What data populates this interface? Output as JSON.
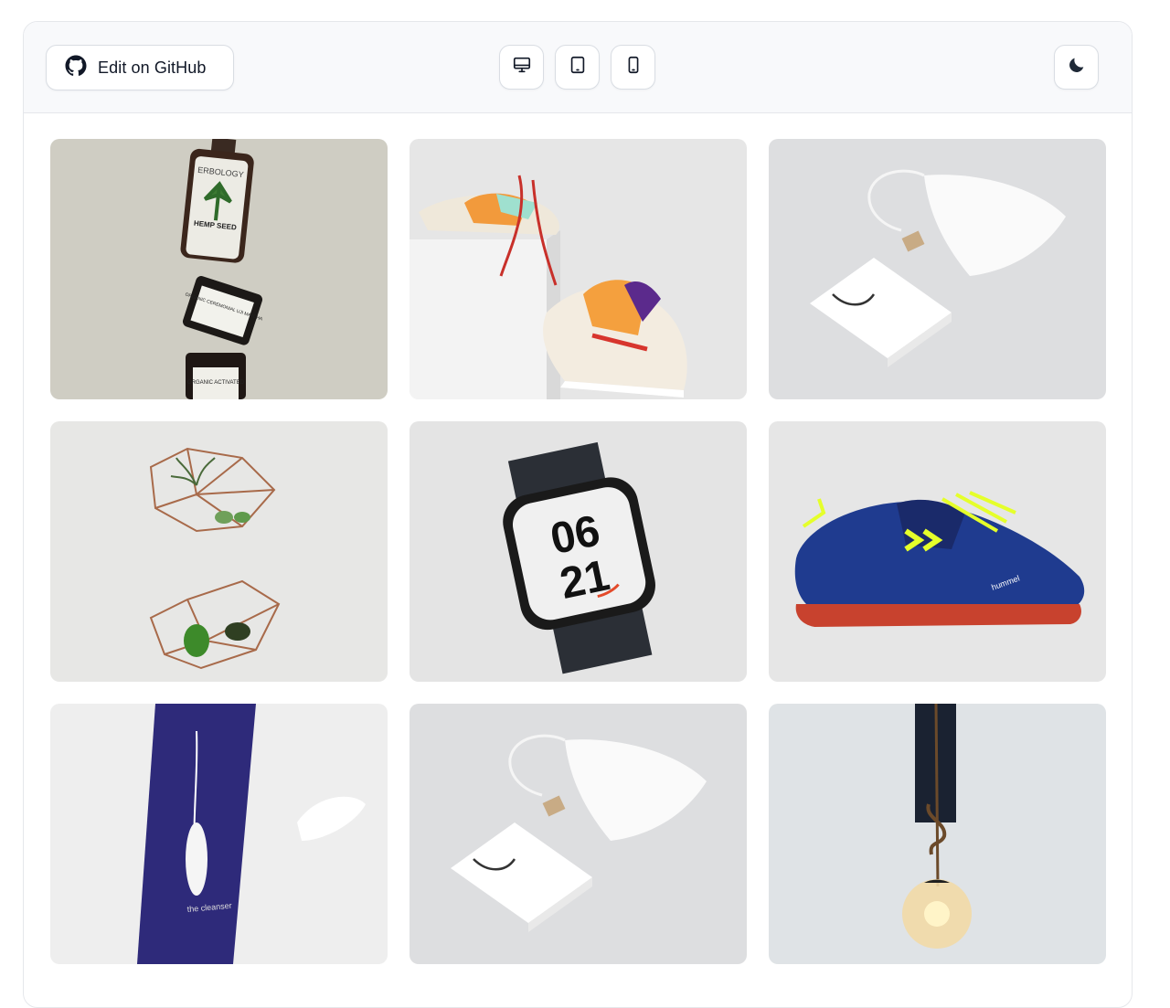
{
  "toolbar": {
    "github_label": "Edit on GitHub",
    "github_icon": "github-icon",
    "view_buttons": [
      "desktop-icon",
      "tablet-icon",
      "mobile-icon"
    ],
    "theme_icon": "moon-icon"
  },
  "gallery": {
    "items": [
      {
        "subject": "stacked cosmetic bottles and jars",
        "bottle_brand": "ERBOLOGY",
        "bottle_label": "HEMP SEED",
        "jar_label": "ORGANIC CEREMONIAL UJI MATCHA",
        "jar2_label": "ORGANIC ACTIVATED"
      },
      {
        "subject": "pair of multicolor sneakers on white box"
      },
      {
        "subject": "white pouch and paper bag mockup"
      },
      {
        "subject": "geometric copper terrariums with plants"
      },
      {
        "subject": "smartwatch with black sport loop",
        "watch_top": "06",
        "watch_bottom": "21"
      },
      {
        "subject": "blue and neon football shoe",
        "brand": "hummel"
      },
      {
        "subject": "purple cleanser tube with cream swatch",
        "tube_label": "the cleanser"
      },
      {
        "subject": "white pouch and paper bag mockup"
      },
      {
        "subject": "pendant globe lamp on dark wall"
      }
    ]
  },
  "colors": {
    "toolbar_bg": "#f8f9fb",
    "border": "#e5e7eb",
    "text": "#111827"
  }
}
